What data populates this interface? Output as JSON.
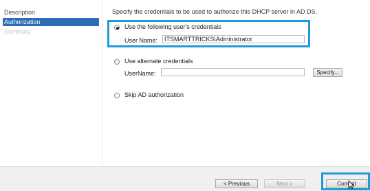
{
  "sidebar": {
    "items": [
      {
        "label": "Description"
      },
      {
        "label": "Authorization"
      },
      {
        "label": "Summary"
      }
    ]
  },
  "main": {
    "description": "Specify the credentials to be used to authorize this DHCP server in AD DS.",
    "option_following": {
      "label": "Use the following user's credentials",
      "username_label": "User Name:",
      "username_value": "ITSMARTTRICKS\\Administrator"
    },
    "option_alternate": {
      "label": "Use alternate credentials",
      "username_label": "UserName:",
      "username_value": "",
      "specify_label": "Specify..."
    },
    "option_skip": {
      "label": "Skip AD authorization"
    }
  },
  "footer": {
    "previous_label": "< Previous",
    "next_label": "Next >",
    "commit_label": "Commit"
  },
  "colors": {
    "selected_nav": "#2d6db5",
    "highlight": "#1e9bd7"
  }
}
